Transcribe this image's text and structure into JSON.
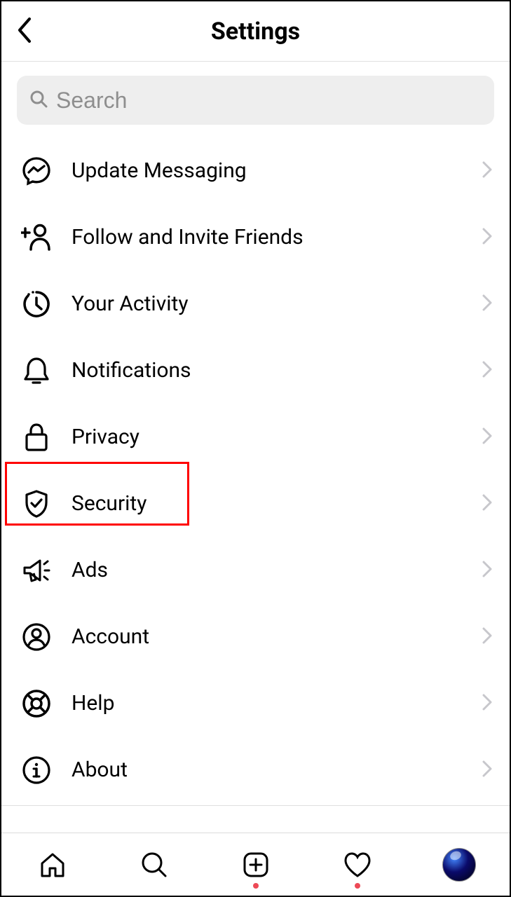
{
  "header": {
    "title": "Settings"
  },
  "search": {
    "placeholder": "Search"
  },
  "items": [
    {
      "label": "Update Messaging",
      "icon": "messenger"
    },
    {
      "label": "Follow and Invite Friends",
      "icon": "add-person"
    },
    {
      "label": "Your Activity",
      "icon": "activity"
    },
    {
      "label": "Notifications",
      "icon": "bell"
    },
    {
      "label": "Privacy",
      "icon": "lock"
    },
    {
      "label": "Security",
      "icon": "shield",
      "highlighted": true
    },
    {
      "label": "Ads",
      "icon": "megaphone"
    },
    {
      "label": "Account",
      "icon": "account"
    },
    {
      "label": "Help",
      "icon": "help"
    },
    {
      "label": "About",
      "icon": "info"
    }
  ],
  "nav": {
    "activity_dot": true,
    "heart_dot": true
  }
}
